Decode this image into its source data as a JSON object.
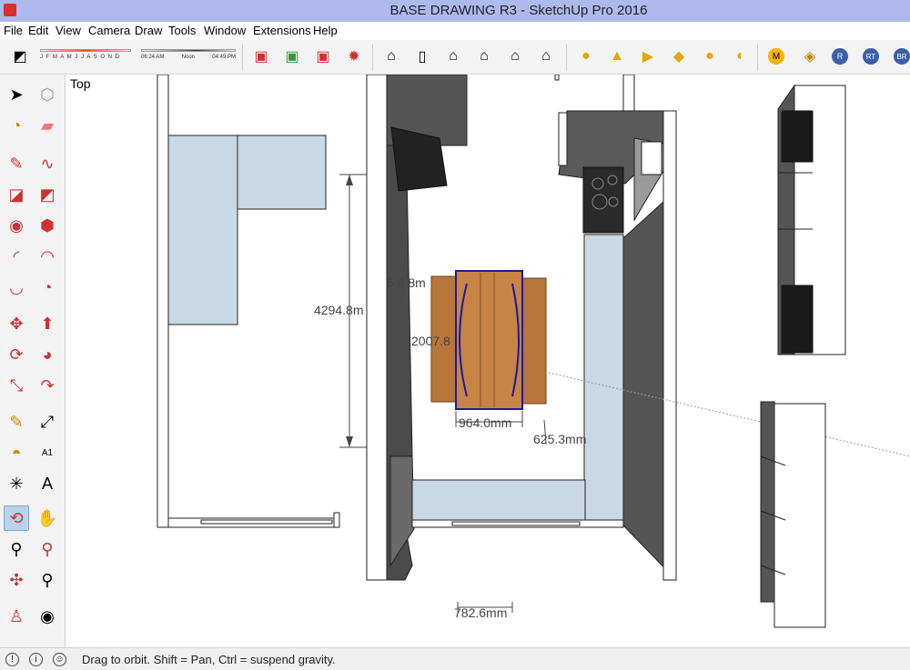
{
  "window": {
    "title": "BASE DRAWING R3 - SketchUp Pro 2016"
  },
  "menu": [
    "File",
    "Edit",
    "View",
    "Camera",
    "Draw",
    "Tools",
    "Window",
    "Extensions",
    "Help"
  ],
  "shadow_widget": {
    "months": "J F M A M J J A S O N D",
    "time_start": "06:24 AM",
    "time_mid": "Noon",
    "time_end": "04:49 PM"
  },
  "viewport": {
    "view_name": "Top"
  },
  "dimensions": {
    "d1": "4294.8m",
    "d2": "5 8.8m",
    "d3": "2007.8",
    "d4": "964.0mm",
    "d5": "625.3mm",
    "d6": "782.6mm"
  },
  "statusbar": {
    "message": "Drag to orbit. Shift = Pan, Ctrl = suspend gravity."
  },
  "toolbar_ext": {
    "m": "M",
    "r": "R",
    "rt": "RT",
    "br": "BR"
  },
  "colors": {
    "titlebar": "#aeb9ee",
    "counter": "#c9d9e3",
    "wood": "#b8763a",
    "wall": "#ffffff",
    "selected": "#1a1aa0"
  }
}
